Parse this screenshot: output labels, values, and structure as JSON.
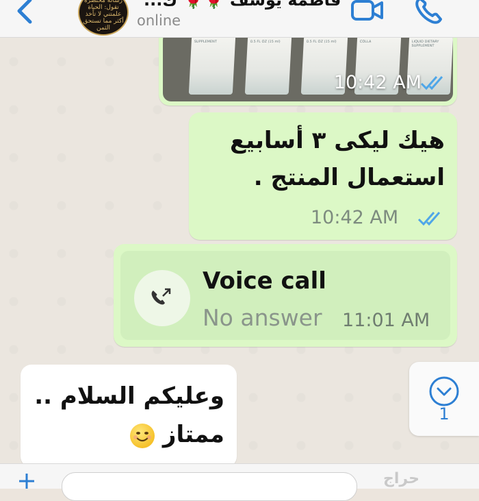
{
  "header": {
    "contact_name": "فاطمة يوسف 🌹🌹 ك...",
    "status": "online",
    "avatar_text": "رسالة مختصرة تقول: الحياة علمتني لا تأخذ أكثر مما تستحق الثمن"
  },
  "messages": [
    {
      "type": "image",
      "time": "10:42 AM",
      "status": "read",
      "photo_labels": [
        "SUPPLEMENT",
        "0.5 FL OZ (15 ml)",
        "0.5 FL OZ (15 ml)",
        "COLLA",
        "LIQUID DIETARY SUPPLEMENT"
      ]
    },
    {
      "type": "text",
      "text_line1": "هيك  ليكى ٣ أسابيع",
      "text_line2": "استعمال المنتج .",
      "time": "10:42 AM",
      "status": "read"
    },
    {
      "type": "call",
      "title": "Voice call",
      "subtitle": "No answer",
      "time": "11:01 AM"
    },
    {
      "type": "incoming",
      "text_line1": "وعليكم السلام ..",
      "text_line2": "ممتاز"
    }
  ],
  "scroll": {
    "count": "1"
  },
  "watermark": "حراج",
  "colors": {
    "accent": "#2d7fd3",
    "outgoing": "#dcf8c6",
    "read_ticks": "#4fa6e8"
  }
}
